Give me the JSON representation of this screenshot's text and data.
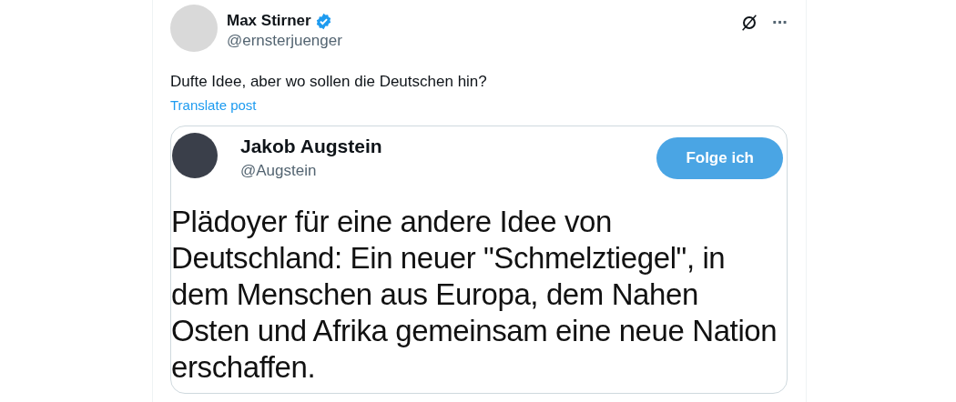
{
  "post": {
    "author": {
      "name": "Max Stirner",
      "handle": "@ernsterjuenger",
      "verified": true
    },
    "text": "Dufte Idee, aber wo sollen die Deutschen hin?",
    "translate_link": "Translate post",
    "more_menu": "···",
    "embedded_screenshot": {
      "author": {
        "name": "Jakob Augstein",
        "handle": "@Augstein"
      },
      "follow_button": "Folge ich",
      "text": "Plädoyer für eine andere Idee von Deutschland: Ein neuer \"Schmelztiegel\", in dem Menschen aus Europa, dem Nahen Osten und Afrika gemeinsam eine neue Nation erschaffen."
    }
  }
}
